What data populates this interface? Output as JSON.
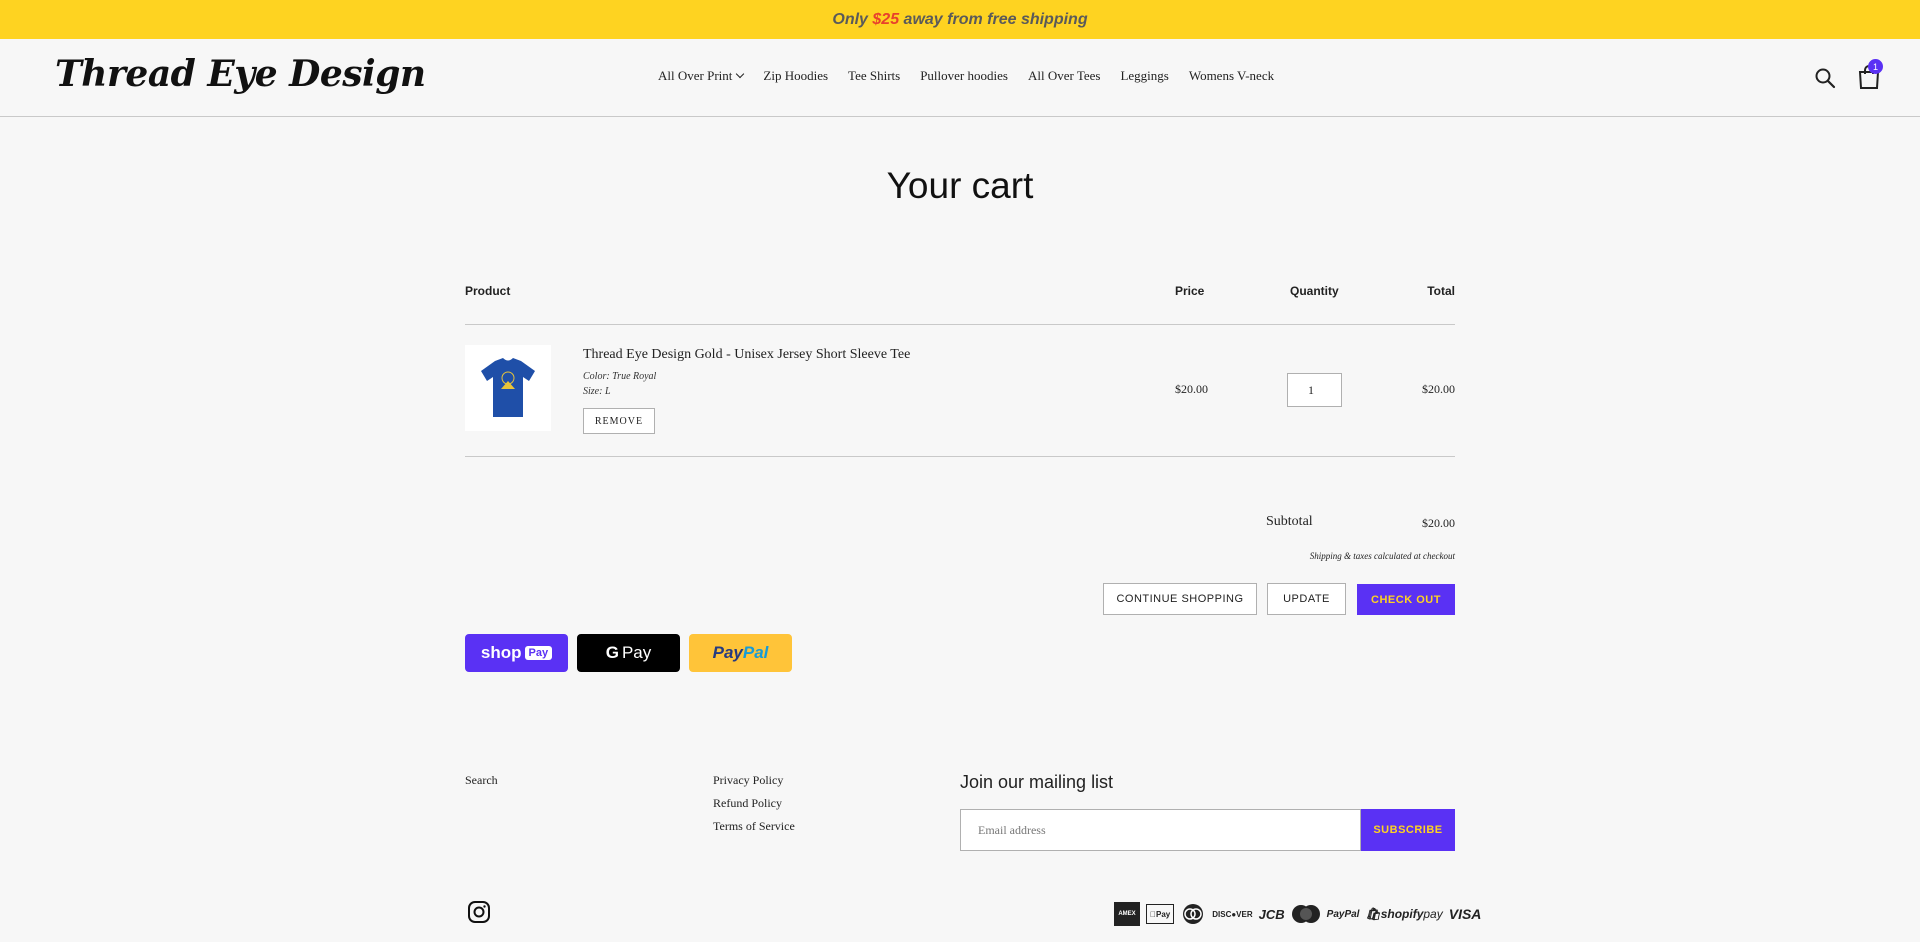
{
  "announcement": {
    "prefix": "Only ",
    "amount": "$25",
    "suffix": " away from free shipping"
  },
  "header": {
    "logo": "Thread Eye Design",
    "nav": [
      "All Over Print",
      "Zip Hoodies",
      "Tee Shirts",
      "Pullover hoodies",
      "All Over Tees",
      "Leggings",
      "Womens V-neck"
    ],
    "cart_count": "1"
  },
  "cart": {
    "title": "Your cart",
    "headers": {
      "product": "Product",
      "price": "Price",
      "quantity": "Quantity",
      "total": "Total"
    },
    "item": {
      "name": "Thread Eye Design Gold - Unisex Jersey Short Sleeve Tee",
      "color": "Color: True Royal",
      "size": "Size: L",
      "remove": "Remove",
      "price": "$20.00",
      "quantity": "1",
      "total": "$20.00",
      "shirt_color": "#1f4fa8"
    },
    "subtotal_label": "Subtotal",
    "subtotal_value": "$20.00",
    "shipping_note": "Shipping & taxes calculated at checkout",
    "continue": "CONTINUE SHOPPING",
    "update": "UPDATE",
    "checkout": "CHECK OUT"
  },
  "express": {
    "shop": "shop",
    "shop_pill": "Pay",
    "gpay": "Pay",
    "paypal_a": "Pay",
    "paypal_b": "Pal"
  },
  "footer": {
    "links_col1": [
      "Search"
    ],
    "links_col2": [
      "Privacy Policy",
      "Refund Policy",
      "Terms of Service"
    ],
    "mailing_title": "Join our mailing list",
    "email_placeholder": "Email address",
    "subscribe": "SUBSCRIBE",
    "payment_icons": [
      "american-express",
      "apple-pay",
      "diners-club",
      "discover",
      "jcb",
      "mastercard",
      "paypal",
      "shopify-pay",
      "visa"
    ]
  },
  "colors": {
    "accent": "#5a31f4",
    "announce_bg": "#fed321",
    "amount": "#e8412c"
  }
}
